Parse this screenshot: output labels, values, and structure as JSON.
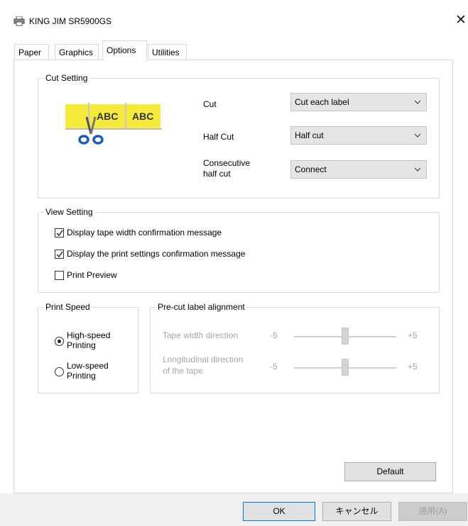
{
  "window": {
    "title": "KING JIM SR5900GS",
    "close_glyph": "✕"
  },
  "tabs": [
    {
      "label": "Paper",
      "active": false
    },
    {
      "label": "Graphics",
      "active": false
    },
    {
      "label": "Options",
      "active": true
    },
    {
      "label": "Utilities",
      "active": false
    }
  ],
  "cut_setting": {
    "group_label": "Cut Setting",
    "illustration": {
      "text1": "ABC",
      "text2": "ABC"
    },
    "cut": {
      "label": "Cut",
      "value": "Cut each label"
    },
    "half_cut": {
      "label": "Half Cut",
      "value": "Half cut"
    },
    "consecutive": {
      "label_line1": "Consecutive",
      "label_line2": "half cut",
      "value": "Connect"
    }
  },
  "view_setting": {
    "group_label": "View Setting",
    "items": [
      {
        "label": "Display tape width confirmation message",
        "checked": true
      },
      {
        "label": "Display the print settings confirmation message",
        "checked": true
      },
      {
        "label": "Print Preview",
        "checked": false
      }
    ]
  },
  "print_speed": {
    "group_label": "Print Speed",
    "options": [
      {
        "line1": "High-speed",
        "line2": "Printing",
        "selected": true
      },
      {
        "line1": "Low-speed",
        "line2": "Printing",
        "selected": false
      }
    ]
  },
  "precut": {
    "group_label": "Pre-cut label alignment",
    "tape_width": {
      "label": "Tape width direction",
      "min": "-5",
      "max": "+5",
      "value": 0
    },
    "longitudinal": {
      "label_line1": "Longitudinal direction",
      "label_line2": "of the tape",
      "min": "-5",
      "max": "+5",
      "value": 0
    }
  },
  "buttons": {
    "default": "Default",
    "ok": "OK",
    "cancel": "キャンセル",
    "apply": "適用(A)"
  },
  "colors": {
    "accent": "#0078d7",
    "label_yellow": "#f5ea3c",
    "scissors_blue": "#1a5fb4"
  }
}
